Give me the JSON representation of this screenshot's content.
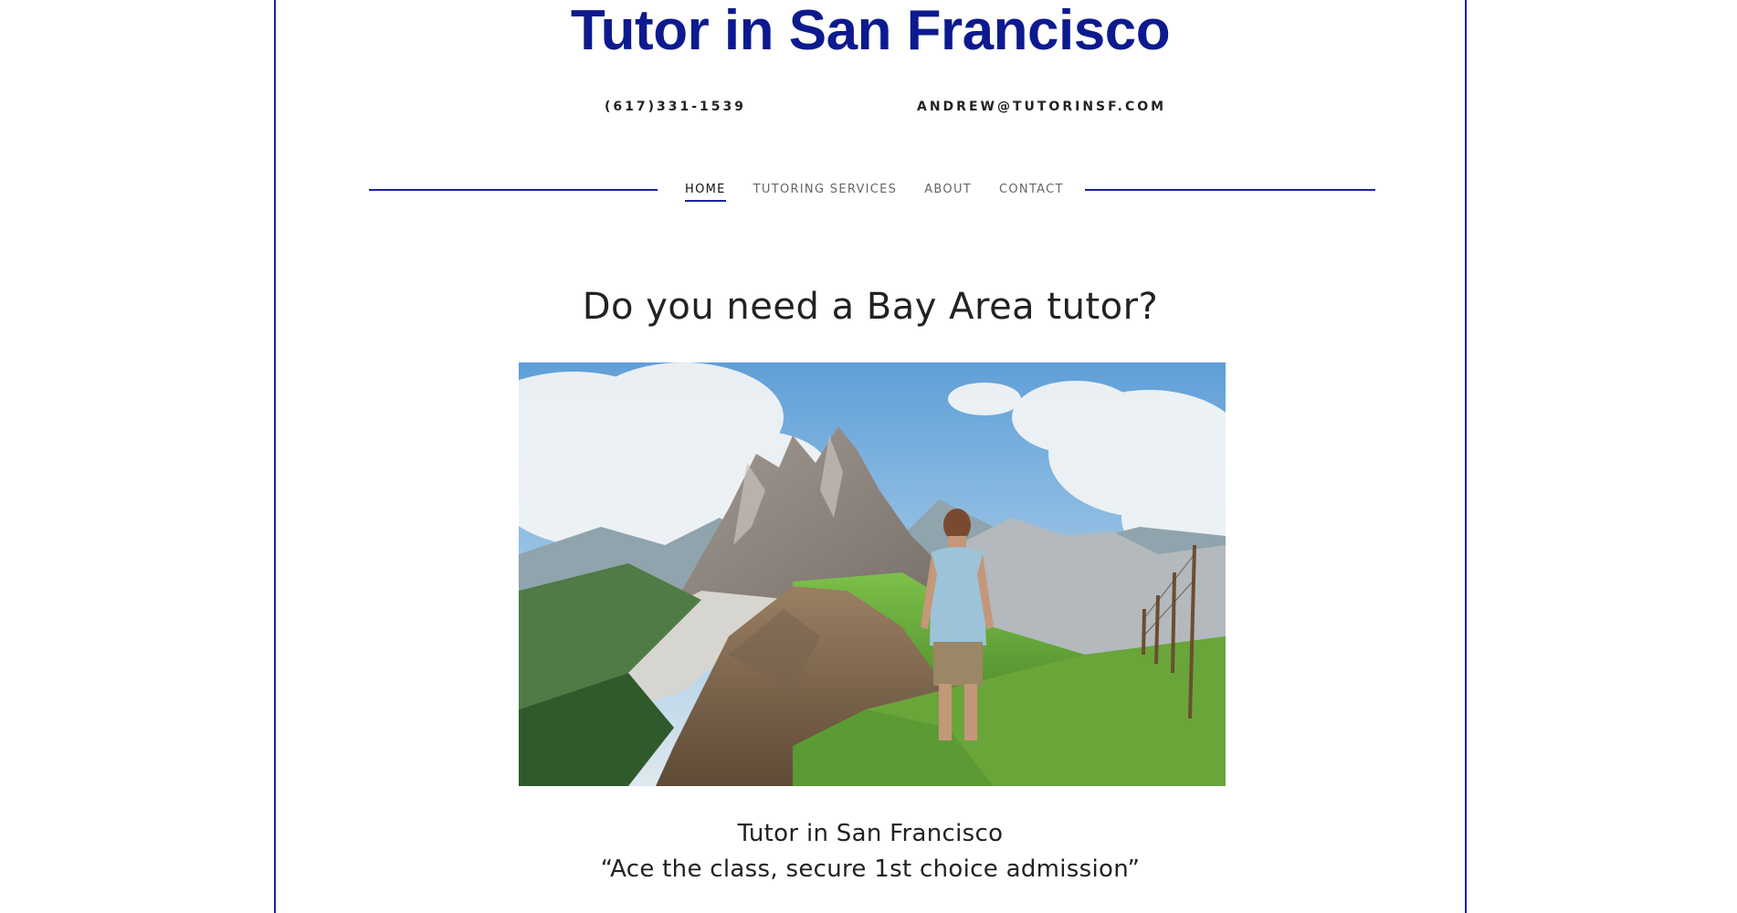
{
  "header": {
    "site_title": "Tutor in San Francisco",
    "phone": "(617)331-1539",
    "email": "ANDREW@TUTORINSF.COM"
  },
  "nav": {
    "items": [
      {
        "label": "HOME",
        "active": true
      },
      {
        "label": "TUTORING SERVICES",
        "active": false
      },
      {
        "label": "ABOUT",
        "active": false
      },
      {
        "label": "CONTACT",
        "active": false
      }
    ]
  },
  "main": {
    "headline": "Do you need a Bay Area tutor?",
    "caption_line1": "Tutor in San Francisco",
    "caption_line2": "“Ace the class, secure 1st choice admission”"
  },
  "colors": {
    "brand_blue": "#0d1a8f",
    "rule_blue": "#1a23a0"
  }
}
